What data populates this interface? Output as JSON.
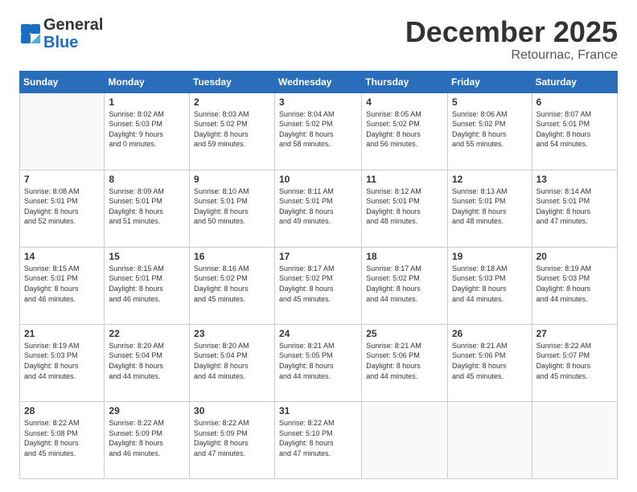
{
  "header": {
    "logo_general": "General",
    "logo_blue": "Blue",
    "month": "December 2025",
    "location": "Retournac, France"
  },
  "weekdays": [
    "Sunday",
    "Monday",
    "Tuesday",
    "Wednesday",
    "Thursday",
    "Friday",
    "Saturday"
  ],
  "weeks": [
    [
      {
        "day": "",
        "detail": ""
      },
      {
        "day": "1",
        "detail": "Sunrise: 8:02 AM\nSunset: 5:03 PM\nDaylight: 9 hours\nand 0 minutes."
      },
      {
        "day": "2",
        "detail": "Sunrise: 8:03 AM\nSunset: 5:02 PM\nDaylight: 8 hours\nand 59 minutes."
      },
      {
        "day": "3",
        "detail": "Sunrise: 8:04 AM\nSunset: 5:02 PM\nDaylight: 8 hours\nand 58 minutes."
      },
      {
        "day": "4",
        "detail": "Sunrise: 8:05 AM\nSunset: 5:02 PM\nDaylight: 8 hours\nand 56 minutes."
      },
      {
        "day": "5",
        "detail": "Sunrise: 8:06 AM\nSunset: 5:02 PM\nDaylight: 8 hours\nand 55 minutes."
      },
      {
        "day": "6",
        "detail": "Sunrise: 8:07 AM\nSunset: 5:01 PM\nDaylight: 8 hours\nand 54 minutes."
      }
    ],
    [
      {
        "day": "7",
        "detail": "Sunrise: 8:08 AM\nSunset: 5:01 PM\nDaylight: 8 hours\nand 52 minutes."
      },
      {
        "day": "8",
        "detail": "Sunrise: 8:09 AM\nSunset: 5:01 PM\nDaylight: 8 hours\nand 51 minutes."
      },
      {
        "day": "9",
        "detail": "Sunrise: 8:10 AM\nSunset: 5:01 PM\nDaylight: 8 hours\nand 50 minutes."
      },
      {
        "day": "10",
        "detail": "Sunrise: 8:11 AM\nSunset: 5:01 PM\nDaylight: 8 hours\nand 49 minutes."
      },
      {
        "day": "11",
        "detail": "Sunrise: 8:12 AM\nSunset: 5:01 PM\nDaylight: 8 hours\nand 48 minutes."
      },
      {
        "day": "12",
        "detail": "Sunrise: 8:13 AM\nSunset: 5:01 PM\nDaylight: 8 hours\nand 48 minutes."
      },
      {
        "day": "13",
        "detail": "Sunrise: 8:14 AM\nSunset: 5:01 PM\nDaylight: 8 hours\nand 47 minutes."
      }
    ],
    [
      {
        "day": "14",
        "detail": "Sunrise: 8:15 AM\nSunset: 5:01 PM\nDaylight: 8 hours\nand 46 minutes."
      },
      {
        "day": "15",
        "detail": "Sunrise: 8:15 AM\nSunset: 5:01 PM\nDaylight: 8 hours\nand 46 minutes."
      },
      {
        "day": "16",
        "detail": "Sunrise: 8:16 AM\nSunset: 5:02 PM\nDaylight: 8 hours\nand 45 minutes."
      },
      {
        "day": "17",
        "detail": "Sunrise: 8:17 AM\nSunset: 5:02 PM\nDaylight: 8 hours\nand 45 minutes."
      },
      {
        "day": "18",
        "detail": "Sunrise: 8:17 AM\nSunset: 5:02 PM\nDaylight: 8 hours\nand 44 minutes."
      },
      {
        "day": "19",
        "detail": "Sunrise: 8:18 AM\nSunset: 5:03 PM\nDaylight: 8 hours\nand 44 minutes."
      },
      {
        "day": "20",
        "detail": "Sunrise: 8:19 AM\nSunset: 5:03 PM\nDaylight: 8 hours\nand 44 minutes."
      }
    ],
    [
      {
        "day": "21",
        "detail": "Sunrise: 8:19 AM\nSunset: 5:03 PM\nDaylight: 8 hours\nand 44 minutes."
      },
      {
        "day": "22",
        "detail": "Sunrise: 8:20 AM\nSunset: 5:04 PM\nDaylight: 8 hours\nand 44 minutes."
      },
      {
        "day": "23",
        "detail": "Sunrise: 8:20 AM\nSunset: 5:04 PM\nDaylight: 8 hours\nand 44 minutes."
      },
      {
        "day": "24",
        "detail": "Sunrise: 8:21 AM\nSunset: 5:05 PM\nDaylight: 8 hours\nand 44 minutes."
      },
      {
        "day": "25",
        "detail": "Sunrise: 8:21 AM\nSunset: 5:06 PM\nDaylight: 8 hours\nand 44 minutes."
      },
      {
        "day": "26",
        "detail": "Sunrise: 8:21 AM\nSunset: 5:06 PM\nDaylight: 8 hours\nand 45 minutes."
      },
      {
        "day": "27",
        "detail": "Sunrise: 8:22 AM\nSunset: 5:07 PM\nDaylight: 8 hours\nand 45 minutes."
      }
    ],
    [
      {
        "day": "28",
        "detail": "Sunrise: 8:22 AM\nSunset: 5:08 PM\nDaylight: 8 hours\nand 45 minutes."
      },
      {
        "day": "29",
        "detail": "Sunrise: 8:22 AM\nSunset: 5:09 PM\nDaylight: 8 hours\nand 46 minutes."
      },
      {
        "day": "30",
        "detail": "Sunrise: 8:22 AM\nSunset: 5:09 PM\nDaylight: 8 hours\nand 47 minutes."
      },
      {
        "day": "31",
        "detail": "Sunrise: 8:22 AM\nSunset: 5:10 PM\nDaylight: 8 hours\nand 47 minutes."
      },
      {
        "day": "",
        "detail": ""
      },
      {
        "day": "",
        "detail": ""
      },
      {
        "day": "",
        "detail": ""
      }
    ]
  ]
}
